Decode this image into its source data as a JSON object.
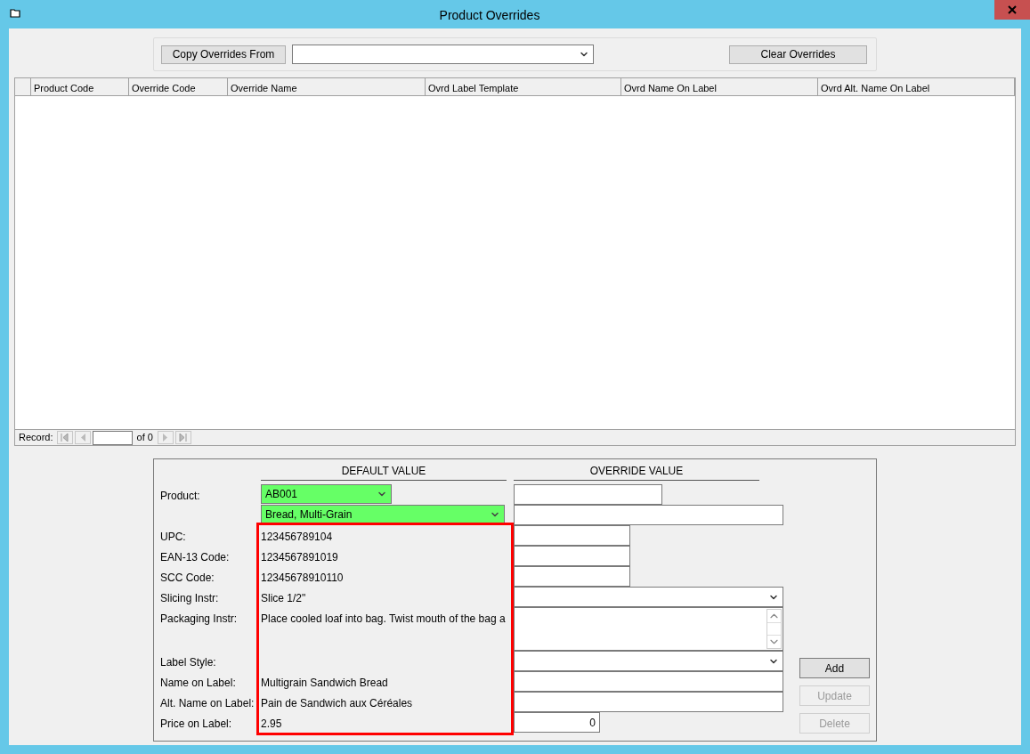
{
  "window": {
    "title": "Product Overrides"
  },
  "toolbar": {
    "copy_button": "Copy Overrides From",
    "clear_button": "Clear Overrides"
  },
  "table": {
    "columns": [
      "Product Code",
      "Override Code",
      "Override Name",
      "Ovrd Label Template",
      "Ovrd Name On Label",
      "Ovrd Alt. Name On Label"
    ]
  },
  "navigator": {
    "label": "Record:",
    "total": "of 0"
  },
  "form": {
    "default_heading": "DEFAULT VALUE",
    "override_heading": "OVERRIDE VALUE",
    "groups": [
      {
        "highlighted": false,
        "rows": [
          {
            "label": "Product:",
            "default": {
              "kind": "codeselect",
              "value": "AB001"
            },
            "override": {
              "kind": "medium"
            }
          },
          {
            "default": {
              "kind": "select",
              "value": "Bread, Multi-Grain"
            },
            "override": {
              "kind": "wide"
            }
          }
        ]
      },
      {
        "highlighted": true,
        "rows": [
          {
            "label": "UPC:",
            "default": {
              "kind": "text",
              "value": "123456789104"
            },
            "override": {
              "kind": "short"
            }
          },
          {
            "label": "EAN-13 Code:",
            "default": {
              "kind": "text",
              "value": "1234567891019"
            },
            "override": {
              "kind": "short"
            }
          },
          {
            "label": "SCC Code:",
            "default": {
              "kind": "text",
              "value": "12345678910110"
            },
            "override": {
              "kind": "short"
            }
          },
          {
            "label": "Slicing Instr:",
            "default": {
              "kind": "text",
              "value": "Slice 1/2\""
            },
            "override": {
              "kind": "select"
            }
          },
          {
            "label": "Packaging Instr:",
            "default": {
              "kind": "text",
              "value": "Place cooled loaf into bag. Twist mouth of the bag a"
            },
            "override": {
              "kind": "textarea"
            }
          },
          {
            "label": "Label Style:",
            "default": {
              "kind": "text"
            },
            "override": {
              "kind": "select"
            }
          },
          {
            "label": "Name on Label:",
            "default": {
              "kind": "text",
              "value": "Multigrain Sandwich Bread"
            },
            "override": {
              "kind": "wide"
            }
          },
          {
            "label": "Alt. Name on Label:",
            "default": {
              "kind": "text",
              "value": "Pain de Sandwich aux Céréales"
            },
            "override": {
              "kind": "wide"
            }
          },
          {
            "label": "Price on Label:",
            "default": {
              "kind": "text",
              "value": "2.95"
            },
            "override": {
              "kind": "number",
              "value": "0"
            }
          }
        ]
      }
    ]
  },
  "actions": [
    {
      "label": "Add",
      "disabled": false
    },
    {
      "label": "Update",
      "disabled": true
    },
    {
      "label": "Delete",
      "disabled": true
    }
  ]
}
